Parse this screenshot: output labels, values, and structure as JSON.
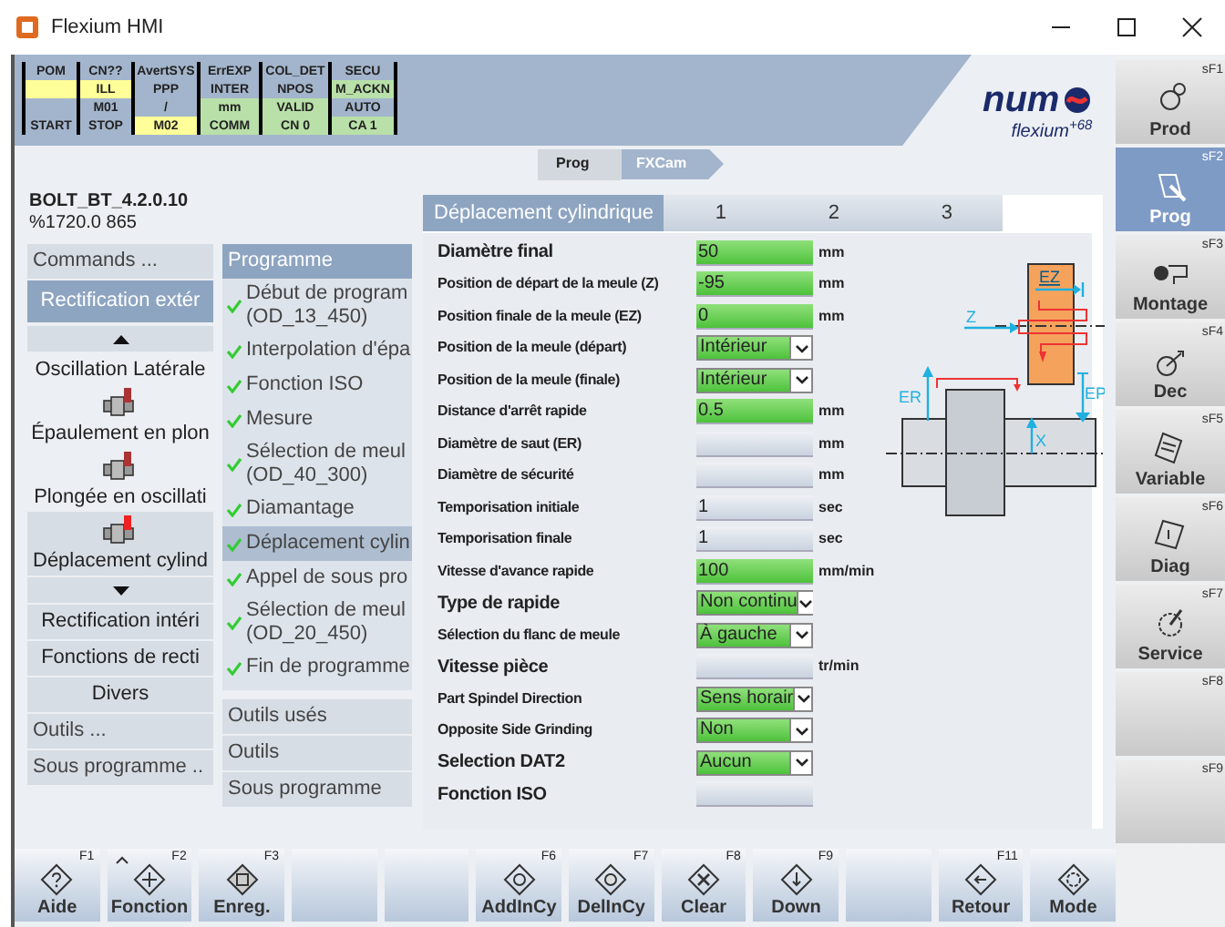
{
  "window": {
    "title": "Flexium HMI"
  },
  "status_grid": [
    [
      {
        "text": "POM",
        "color": "#a3b5cc"
      },
      {
        "text": "CN??",
        "color": "#a3b5cc"
      },
      {
        "text": "AvertSYS",
        "color": "#a3b5cc"
      },
      {
        "text": "ErrEXP",
        "color": "#a3b5cc"
      },
      {
        "text": "COL_DET",
        "color": "#a3b5cc"
      },
      {
        "text": "SECU",
        "color": "#a3b5cc"
      }
    ],
    [
      {
        "color": "#ffff99"
      },
      {
        "text": "ILL",
        "color": "#ffff99"
      },
      {
        "text": "PPP",
        "color": "#a3b5cc"
      },
      {
        "text": "INTER",
        "color": "#a3b5cc"
      },
      {
        "text": "NPOS",
        "color": "#a3b5cc"
      },
      {
        "text": "M_ACKN",
        "color": "#b8e0a8"
      }
    ],
    [
      {
        "color": "#a3b5cc"
      },
      {
        "text": "M01",
        "color": "#a3b5cc"
      },
      {
        "text": "/",
        "color": "#a3b5cc"
      },
      {
        "text": "mm",
        "color": "#b8e0a8"
      },
      {
        "text": "VALID",
        "color": "#b8e0a8"
      },
      {
        "text": "AUTO",
        "color": "#a3b5cc"
      }
    ],
    [
      {
        "text": "START",
        "color": "#a3b5cc"
      },
      {
        "text": "STOP",
        "color": "#a3b5cc"
      },
      {
        "text": "M02",
        "color": "#ffff99"
      },
      {
        "text": "COMM",
        "color": "#b8e0a8"
      },
      {
        "text": "CN 0",
        "color": "#b8e0a8"
      },
      {
        "text": "CA 1",
        "color": "#b8e0a8"
      }
    ]
  ],
  "logo": {
    "brand": "num",
    "product": "flexium$^{+68}$"
  },
  "breadcrumb": [
    {
      "label": "Prog"
    },
    {
      "label": "FXCam"
    }
  ],
  "program": {
    "name": "BOLT_BT_4.2.0.10",
    "number": "%1720.0 865"
  },
  "commands": [
    {
      "kind": "header",
      "text": "Commands ..."
    },
    {
      "kind": "button",
      "text": "Rectification extér",
      "selected": true
    },
    {
      "kind": "scroll-up"
    },
    {
      "kind": "label",
      "text": "Oscillation Latérale",
      "selected": false
    },
    {
      "kind": "tool",
      "text": "Épaulement en plon",
      "selected": false
    },
    {
      "kind": "tool",
      "text": "Plongée en oscillati",
      "selected": false
    },
    {
      "kind": "tool",
      "text": "Déplacement cylind",
      "selected": true
    },
    {
      "kind": "scroll-down"
    },
    {
      "kind": "button",
      "text": "Rectification intéri",
      "selected": false
    },
    {
      "kind": "button",
      "text": "Fonctions de recti",
      "selected": false
    },
    {
      "kind": "button",
      "text": "Divers",
      "selected": false
    },
    {
      "kind": "header",
      "text": "Outils ..."
    },
    {
      "kind": "header",
      "text": "Sous programme .."
    }
  ],
  "program_steps": [
    {
      "kind": "title",
      "text": "Programme"
    },
    {
      "kind": "step",
      "text": "Début de program",
      "detail": "(OD_13_450)",
      "done": true,
      "selected": false
    },
    {
      "kind": "step",
      "text": "Interpolation d'épa",
      "done": true,
      "selected": false
    },
    {
      "kind": "step",
      "text": "Fonction ISO",
      "done": true,
      "selected": false
    },
    {
      "kind": "step",
      "text": "Mesure",
      "done": true,
      "selected": false
    },
    {
      "kind": "step",
      "text": "Sélection de meul",
      "detail": "(OD_40_300)",
      "done": true,
      "selected": false
    },
    {
      "kind": "step",
      "text": "Diamantage",
      "done": true,
      "selected": false
    },
    {
      "kind": "step",
      "text": "Déplacement cylin",
      "done": true,
      "selected": true
    },
    {
      "kind": "step",
      "text": "Appel de sous pro",
      "done": true,
      "selected": false
    },
    {
      "kind": "step",
      "text": "Sélection de meul",
      "detail": "(OD_20_450)",
      "done": true,
      "selected": false
    },
    {
      "kind": "step",
      "text": "Fin de programme",
      "done": true,
      "selected": false
    },
    {
      "kind": "button",
      "text": "Outils usés"
    },
    {
      "kind": "button",
      "text": "Outils"
    },
    {
      "kind": "button",
      "text": "Sous programme"
    }
  ],
  "tabs": [
    {
      "label": "Déplacement cylindrique",
      "selected": true
    },
    {
      "label": "1",
      "selected": false
    },
    {
      "label": "2",
      "selected": false
    },
    {
      "label": "3",
      "selected": false
    }
  ],
  "form": [
    {
      "label": "Diamètre final",
      "heading": true,
      "kind": "input",
      "value": "50",
      "valid": true,
      "unit": "mm"
    },
    {
      "label": "Position de départ de la meule (Z)",
      "heading": false,
      "kind": "input",
      "value": "-95",
      "valid": true,
      "unit": "mm"
    },
    {
      "label": "Position finale de la meule (EZ)",
      "heading": false,
      "kind": "input",
      "value": "0",
      "valid": true,
      "unit": "mm"
    },
    {
      "label": "Position de la meule (départ)",
      "heading": false,
      "kind": "select",
      "value": "Intérieur",
      "valid": true
    },
    {
      "label": "Position de la meule (finale)",
      "heading": false,
      "kind": "select",
      "value": "Intérieur",
      "valid": true
    },
    {
      "label": "Distance d'arrêt rapide",
      "heading": false,
      "kind": "input",
      "value": "0.5",
      "valid": true,
      "unit": "mm"
    },
    {
      "label": "Diamètre de saut (ER)",
      "heading": false,
      "kind": "input",
      "valid": false,
      "unit": "mm"
    },
    {
      "label": "Diamètre de sécurité",
      "heading": false,
      "kind": "input",
      "valid": false,
      "unit": "mm"
    },
    {
      "label": "Temporisation initiale",
      "heading": false,
      "kind": "input",
      "value": "1",
      "valid": false,
      "unit": "sec"
    },
    {
      "label": "Temporisation finale",
      "heading": false,
      "kind": "input",
      "value": "1",
      "valid": false,
      "unit": "sec"
    },
    {
      "label": "Vitesse d'avance rapide",
      "heading": false,
      "kind": "input",
      "value": "100",
      "valid": true,
      "unit": "mm/min"
    },
    {
      "label": "Type de rapide",
      "heading": true,
      "kind": "select",
      "value": "Non continu",
      "valid": true
    },
    {
      "label": "Sélection du flanc de meule",
      "heading": false,
      "kind": "select",
      "value": "À gauche",
      "valid": true
    },
    {
      "label": "Vitesse pièce",
      "heading": true,
      "kind": "input",
      "valid": false,
      "unit": "tr/min"
    },
    {
      "label": "Part Spindel Direction",
      "heading": false,
      "kind": "select",
      "value": "Sens horair",
      "valid": true
    },
    {
      "label": "Opposite Side Grinding",
      "heading": false,
      "kind": "select",
      "value": "Non",
      "valid": true
    },
    {
      "label": "Selection DAT2",
      "heading": true,
      "kind": "select",
      "value": "Aucun",
      "valid": true
    },
    {
      "label": "Fonction ISO",
      "heading": true,
      "kind": "input",
      "valid": false
    }
  ],
  "diagram": {
    "labels": [
      "EZ",
      "Z",
      "ER",
      "EP",
      "X"
    ]
  },
  "side_keys": [
    {
      "key": "sF1",
      "label": "Prod",
      "selected": false
    },
    {
      "key": "sF2",
      "label": "Prog",
      "selected": true
    },
    {
      "key": "sF3",
      "label": "Montage",
      "selected": false
    },
    {
      "key": "sF4",
      "label": "Dec",
      "selected": false
    },
    {
      "key": "sF5",
      "label": "Variable",
      "selected": false
    },
    {
      "key": "sF6",
      "label": "Diag",
      "selected": false
    },
    {
      "key": "sF7",
      "label": "Service",
      "selected": false
    },
    {
      "key": "sF8",
      "selected": false
    },
    {
      "key": "sF9",
      "selected": false
    }
  ],
  "function_keys": [
    {
      "kind": "key",
      "key": "F1",
      "label": "Aide"
    },
    {
      "kind": "key",
      "key": "F2",
      "label": "Fonction",
      "caret": true
    },
    {
      "kind": "key",
      "key": "F3",
      "label": "Enreg."
    },
    {
      "kind": "blank"
    },
    {
      "kind": "blank"
    },
    {
      "kind": "key",
      "key": "F6",
      "label": "AddInCy"
    },
    {
      "kind": "key",
      "key": "F7",
      "label": "DelInCy"
    },
    {
      "kind": "key",
      "key": "F8",
      "label": "Clear"
    },
    {
      "kind": "key",
      "key": "F9",
      "label": "Down"
    },
    {
      "kind": "blank"
    },
    {
      "kind": "key",
      "key": "F11",
      "label": "Retour"
    },
    {
      "kind": "key",
      "label": "Mode"
    }
  ]
}
